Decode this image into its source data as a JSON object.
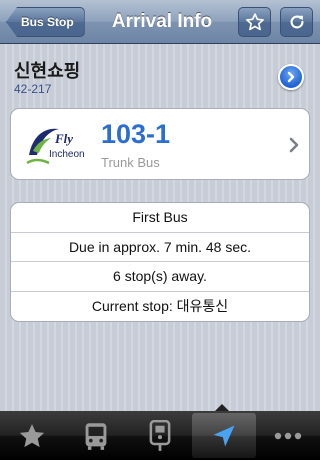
{
  "nav": {
    "back_label": "Bus Stop",
    "title": "Arrival Info",
    "icons": {
      "favorite": "star-icon",
      "refresh": "refresh-icon"
    }
  },
  "stop": {
    "name": "신현쇼핑",
    "code": "42-217",
    "detail_icon": "chevron-right-circle-icon"
  },
  "route": {
    "logo_text": {
      "fly": "Fly",
      "city": "Incheon"
    },
    "number": "103-1",
    "type": "Trunk Bus",
    "colors": {
      "number": "#2a6fd0",
      "logo_green": "#6db33f",
      "logo_navy": "#1e2b6e"
    }
  },
  "arrival": {
    "rows": [
      "First Bus",
      "Due in approx. 7 min. 48 sec.",
      "6 stop(s) away.",
      "Current stop: 대유통신"
    ]
  },
  "tabbar": {
    "tabs": [
      {
        "icon": "star-icon",
        "selected": false
      },
      {
        "icon": "bus-icon",
        "selected": false
      },
      {
        "icon": "bus-stop-icon",
        "selected": false
      },
      {
        "icon": "location-arrow-icon",
        "selected": true
      },
      {
        "icon": "more-icon",
        "selected": false
      }
    ]
  }
}
